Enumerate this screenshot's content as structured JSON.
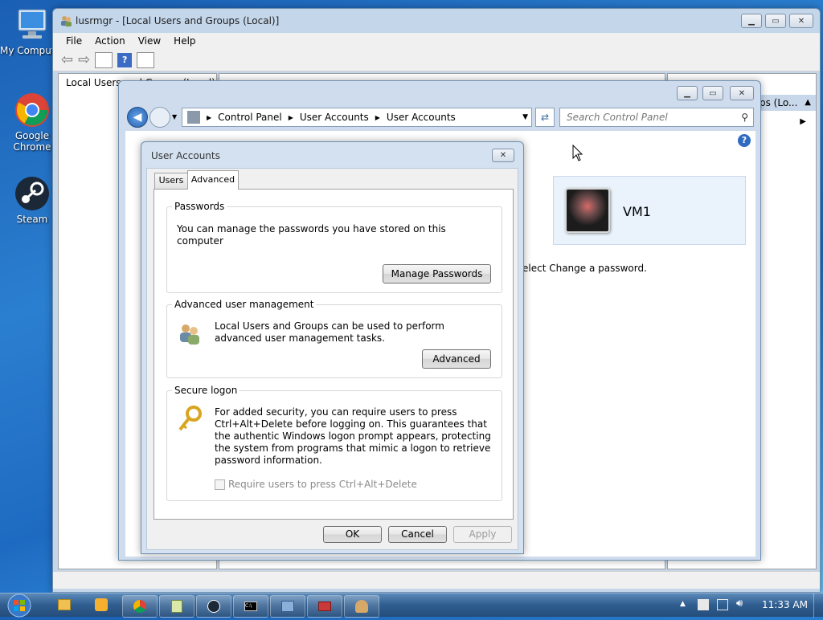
{
  "desktop": {
    "icons": [
      {
        "label": "My Computer",
        "icon": "computer-icon"
      },
      {
        "label": "Google Chrome",
        "icon": "chrome-icon"
      },
      {
        "label": "Steam",
        "icon": "steam-icon"
      }
    ]
  },
  "lusrmgr": {
    "title": "lusrmgr - [Local Users and Groups (Local)]",
    "menu": [
      "File",
      "Action",
      "Help",
      "View"
    ],
    "menu_ordered": [
      "File",
      "Action",
      "View",
      "Help"
    ],
    "tree_root": "Local Users and Groups (Local)",
    "actions_header": "ps (Lo..."
  },
  "control_panel": {
    "breadcrumb": [
      "Control Panel",
      "User Accounts",
      "User Accounts"
    ],
    "search_placeholder": "Search Control Panel",
    "user_name": "VM1",
    "partial_text": "elect Change a password."
  },
  "dialog": {
    "title": "User Accounts",
    "tabs": [
      "Users",
      "Advanced"
    ],
    "active_tab": "Advanced",
    "passwords": {
      "title": "Passwords",
      "text": "You can manage the passwords you have stored on this computer",
      "button": "Manage Passwords"
    },
    "advanced_mgmt": {
      "title": "Advanced user management",
      "text": "Local Users and Groups can be used to perform advanced user management tasks.",
      "button": "Advanced"
    },
    "secure_logon": {
      "title": "Secure logon",
      "text": "For added security, you can require users to press Ctrl+Alt+Delete before logging on. This guarantees that the authentic Windows logon prompt appears, protecting the system from programs that mimic a logon to retrieve password information.",
      "checkbox_label": "Require users to press Ctrl+Alt+Delete",
      "checkbox_checked": false
    },
    "buttons": {
      "ok": "OK",
      "cancel": "Cancel",
      "apply": "Apply"
    }
  },
  "taskbar": {
    "clock": "11:33 AM",
    "apps": [
      "explorer-icon",
      "media-player-icon",
      "chrome-icon",
      "notepad-icon",
      "steam-icon",
      "cmd-icon",
      "mmc-icon",
      "toolbox-icon",
      "users-icon"
    ]
  }
}
